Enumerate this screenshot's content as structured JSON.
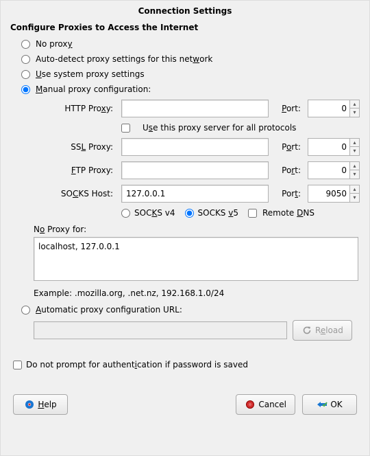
{
  "title": "Connection Settings",
  "heading": "Configure Proxies to Access the Internet",
  "radios": {
    "no_proxy": "No proxy",
    "auto_detect": "Auto-detect proxy settings for this network",
    "use_system": "Use system proxy settings",
    "manual": "Manual proxy configuration:",
    "auto_url": "Automatic proxy configuration URL:"
  },
  "labels": {
    "http": "HTTP Proxy:",
    "ssl": "SSL Proxy:",
    "ftp": "FTP Proxy:",
    "socks": "SOCKS Host:",
    "port": "Port:",
    "use_for_all": "Use this proxy server for all protocols",
    "socks_v4": "SOCKS v4",
    "socks_v5": "SOCKS v5",
    "remote_dns": "Remote DNS",
    "no_proxy_for": "No Proxy for:",
    "example": "Example: .mozilla.org, .net.nz, 192.168.1.0/24",
    "reload": "Reload",
    "no_prompt": "Do not prompt for authentication if password is saved",
    "help": "Help",
    "cancel": "Cancel",
    "ok": "OK"
  },
  "values": {
    "http_host": "",
    "http_port": "0",
    "ssl_host": "",
    "ssl_port": "0",
    "ftp_host": "",
    "ftp_port": "0",
    "socks_host": "127.0.0.1",
    "socks_port": "9050",
    "no_proxy": "localhost, 127.0.0.1",
    "auto_url": ""
  },
  "state": {
    "selected_radio": "manual",
    "use_for_all": false,
    "socks_version": "v5",
    "remote_dns": false,
    "no_prompt": false
  },
  "colors": {
    "red": "#d32f2f",
    "blue": "#1976d2",
    "green": "#4caf50"
  }
}
